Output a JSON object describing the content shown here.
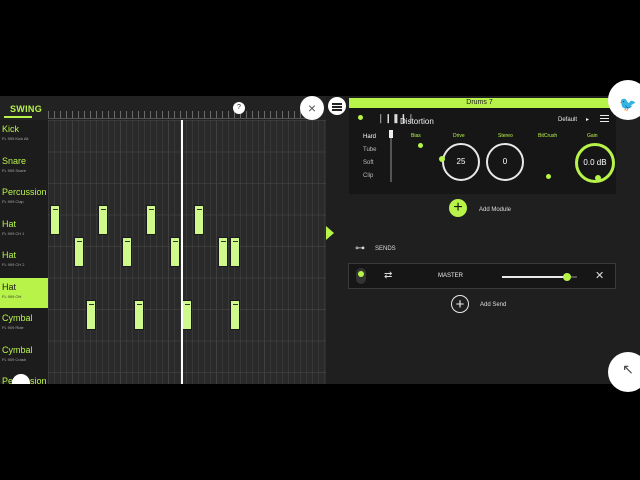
{
  "sequencer": {
    "swing_label": "SWING",
    "knob_mark": "?",
    "close_icon": "×",
    "tracks": [
      {
        "name": "Kick",
        "sub": "FL 909 Kick Alt",
        "selected": false
      },
      {
        "name": "Snare",
        "sub": "FL 909 Snare",
        "selected": false
      },
      {
        "name": "Percussion",
        "sub": "FL 909 Clap",
        "selected": false
      },
      {
        "name": "Hat",
        "sub": "FL 909 CH 1",
        "selected": false
      },
      {
        "name": "Hat",
        "sub": "FL 909 CH 2",
        "selected": false
      },
      {
        "name": "Hat",
        "sub": "FL 909 OH",
        "selected": true
      },
      {
        "name": "Cymbal",
        "sub": "FL 909 Ride",
        "selected": false
      },
      {
        "name": "Cymbal",
        "sub": "FL 909 Crash",
        "selected": false
      },
      {
        "name": "Percussion",
        "sub": "",
        "selected": false
      }
    ],
    "notes": [
      {
        "row": 2,
        "step": 0
      },
      {
        "row": 2,
        "step": 8
      },
      {
        "row": 2,
        "step": 16
      },
      {
        "row": 2,
        "step": 24
      },
      {
        "row": 3,
        "step": 4
      },
      {
        "row": 3,
        "step": 12
      },
      {
        "row": 3,
        "step": 20
      },
      {
        "row": 3,
        "step": 28
      },
      {
        "row": 3,
        "step": 30
      },
      {
        "row": 5,
        "step": 6
      },
      {
        "row": 5,
        "step": 14
      },
      {
        "row": 5,
        "step": 22
      },
      {
        "row": 5,
        "step": 30
      }
    ]
  },
  "panel": {
    "channel_title": "Drums 7",
    "module": {
      "title": "Distortion",
      "preset": "Default",
      "preset_arrow": "▸",
      "wave_icon": "❘❙❚❙❘",
      "modes": [
        "Hard",
        "Tube",
        "Soft",
        "Clip"
      ],
      "active_mode": "Hard",
      "params": {
        "bias": "Bias",
        "drive": "Drive",
        "stereo": "Stereo",
        "bitcrush": "BitCrush",
        "gain": "Gain"
      },
      "drive_value": "25",
      "stereo_value": "0",
      "gain_value": "0.0 dB"
    },
    "add_module_icon": "+",
    "add_module_label": "Add Module",
    "sends_icon": "⊶",
    "sends_label": "SENDS",
    "send": {
      "swap_icon": "⇄",
      "name": "MASTER",
      "level": 0.87,
      "close_icon": "✕"
    },
    "add_send_icon": "+",
    "add_send_label": "Add Send"
  },
  "corners": {
    "top_icon": "🐦",
    "bottom_icon": "↖"
  },
  "colors": {
    "accent": "#b8f34a",
    "note": "#cff98a",
    "background": "#1f1f1f"
  }
}
